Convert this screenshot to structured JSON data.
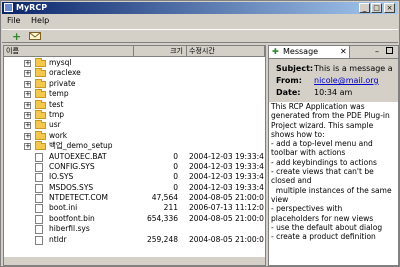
{
  "window": {
    "title": "MyRCP"
  },
  "menu": [
    "File",
    "Help"
  ],
  "table": {
    "columns": [
      "이름",
      "크기",
      "수정시간"
    ],
    "rows": [
      {
        "name": "mysql",
        "type": "folder",
        "size": "",
        "date": ""
      },
      {
        "name": "oraclexe",
        "type": "folder",
        "size": "",
        "date": ""
      },
      {
        "name": "private",
        "type": "folder",
        "size": "",
        "date": ""
      },
      {
        "name": "temp",
        "type": "folder",
        "size": "",
        "date": ""
      },
      {
        "name": "test",
        "type": "folder",
        "size": "",
        "date": ""
      },
      {
        "name": "tmp",
        "type": "folder",
        "size": "",
        "date": ""
      },
      {
        "name": "usr",
        "type": "folder",
        "size": "",
        "date": ""
      },
      {
        "name": "work",
        "type": "folder",
        "size": "",
        "date": ""
      },
      {
        "name": "백업_demo_setup",
        "type": "folder",
        "size": "",
        "date": ""
      },
      {
        "name": "AUTOEXEC.BAT",
        "type": "file",
        "size": "0",
        "date": "2004-12-03 19:33:4"
      },
      {
        "name": "CONFIG.SYS",
        "type": "file",
        "size": "0",
        "date": "2004-12-03 19:33:4"
      },
      {
        "name": "IO.SYS",
        "type": "file",
        "size": "0",
        "date": "2004-12-03 19:33:4"
      },
      {
        "name": "MSDOS.SYS",
        "type": "file",
        "size": "0",
        "date": "2004-12-03 19:33:4"
      },
      {
        "name": "NTDETECT.COM",
        "type": "file",
        "size": "47,564",
        "date": "2004-08-05 21:00:0"
      },
      {
        "name": "boot.ini",
        "type": "file",
        "size": "211",
        "date": "2006-07-13 11:12:0"
      },
      {
        "name": "bootfont.bin",
        "type": "file",
        "size": "654,336",
        "date": "2004-08-05 21:00:0"
      },
      {
        "name": "hiberfil.sys",
        "type": "file",
        "size": "",
        "date": ""
      },
      {
        "name": "ntldr",
        "type": "file",
        "size": "259,248",
        "date": "2004-08-05 21:00:0"
      }
    ]
  },
  "message_view": {
    "tab_label": "Message",
    "subject_label": "Subject:",
    "subject_value": "This is a message a",
    "from_label": "From:",
    "from_value": "nicole@mail.org",
    "date_label": "Date:",
    "date_value": "10:34 am",
    "body": "This RCP Application was\ngenerated from the PDE Plug-in\nProject wizard. This sample\nshows how to:\n- add a top-level menu and\ntoolbar with actions\n- add keybindings to actions\n- create views that can't be\nclosed and\n  multiple instances of the same\nview\n- perspectives with\nplaceholders for new views\n- use the default about dialog\n- create a product definition"
  },
  "colors": {
    "title_start": "#0a246a",
    "title_end": "#a6caf0",
    "folder": "#f5c84c",
    "link": "#0000cc"
  }
}
